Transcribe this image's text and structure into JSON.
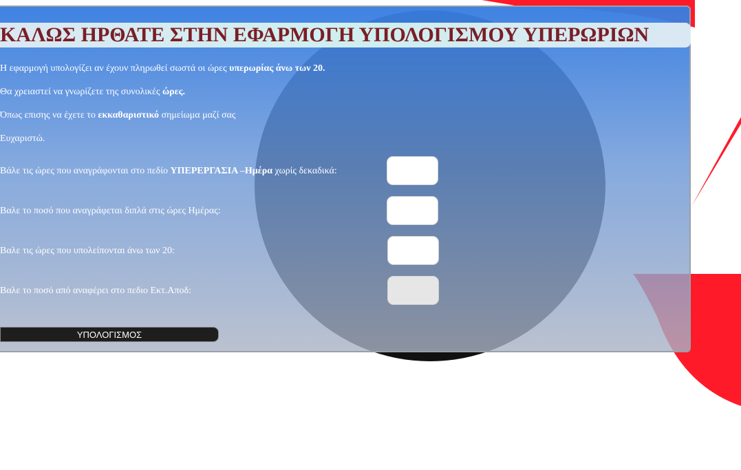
{
  "app": {
    "title": "ΚΑΛΩΣ ΗΡΘΑΤΕ ΣΤΗΝ ΕΦΑΡΜΟΓΗ ΥΠΟΛΟΓΙΣΜΟΥ ΥΠΕΡΩΡΙΩΝ"
  },
  "intro": {
    "line1_a": "Η εφαρμογή υπολογίζει αν έχουν πληρωθεί σωστά οι ώρες ",
    "line1_b": "υπερωρίας άνω των 20.",
    "line2_a": "Θα χρειαστεί να γνωρίζετε της συνολικές ",
    "line2_b": "ώρες.",
    "line3_a": "Όπως επισης να έχετε το ",
    "line3_b": "εκκαθαριστικό",
    "line3_c": " σημείωμα μαζί σας",
    "line4": "Ευχαριστώ."
  },
  "form": {
    "hours_label_a": "Βάλε τις ώρες που αναγράφονται στο πεδίο ",
    "hours_label_b": "ΥΠΕΡΕΡΓΑΣΙΑ –Ημέρα",
    "hours_label_c": " χωρίς δεκαδικά:",
    "amount_label": "Βαλε το ποσό που αναγράφεται διπλά στις ώρες Ημέρας:",
    "remaining_label": "Βαλε τις ώρες που υπολείπονται άνω των 20:",
    "ekt_label": "Βαλε το ποσό από αναφέρει στο πεδιο Εκτ.Αποδ:",
    "hours_value": "",
    "amount_value": "",
    "remaining_value": "",
    "ekt_value": "",
    "calculate_label": "ΥΠΟΛΟΓΙΣΜΟΣ"
  },
  "colors": {
    "title_text": "#7a1e25",
    "panel_top": "#377de1",
    "brand_red": "#ff1a2a",
    "button_bg": "#1e1e1e"
  }
}
